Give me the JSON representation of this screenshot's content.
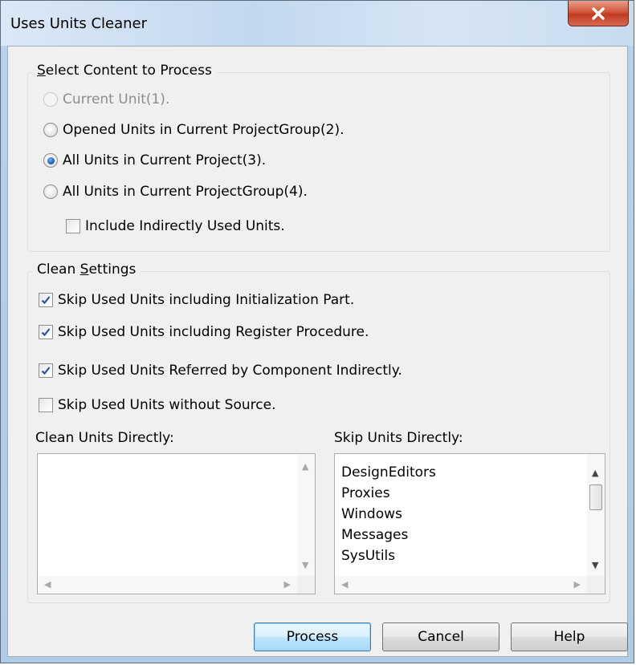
{
  "window": {
    "title": "Uses Units Cleaner",
    "close_icon": "close-icon"
  },
  "content_group": {
    "label_prefix": "",
    "label_mnemonic": "S",
    "label_rest": "elect Content to Process",
    "options": [
      {
        "label": "Current Unit(1).",
        "selected": false,
        "enabled": false
      },
      {
        "label": "Opened Units in Current ProjectGroup(2).",
        "selected": false,
        "enabled": true
      },
      {
        "label": "All Units in Current Project(3).",
        "selected": true,
        "enabled": true
      },
      {
        "label": "All Units in Current ProjectGroup(4).",
        "selected": false,
        "enabled": true
      }
    ],
    "include_indirect": {
      "label": "Include Indirectly Used Units.",
      "checked": false
    }
  },
  "clean_group": {
    "label_prefix": "Clean ",
    "label_mnemonic": "S",
    "label_rest": "ettings",
    "checks": [
      {
        "label": "Skip Used Units including Initialization Part.",
        "checked": true
      },
      {
        "label": "Skip Used Units including Register Procedure.",
        "checked": true
      },
      {
        "label": "Skip Used Units Referred by Component Indirectly.",
        "checked": true
      },
      {
        "label": "Skip Used Units without Source.",
        "checked": false
      }
    ],
    "clean_list": {
      "label": "Clean Units Directly:",
      "items": []
    },
    "skip_list": {
      "label": "Skip Units Directly:",
      "items": [
        "DesignEditors",
        "Proxies",
        "Windows",
        "Messages",
        "SysUtils"
      ]
    }
  },
  "buttons": {
    "process": "Process",
    "cancel": "Cancel",
    "help": "Help"
  },
  "colors": {
    "radio_dot": "#1d5fb4",
    "check_mark": "#2a4e9c",
    "default_button_border": "#3c7fb1"
  }
}
